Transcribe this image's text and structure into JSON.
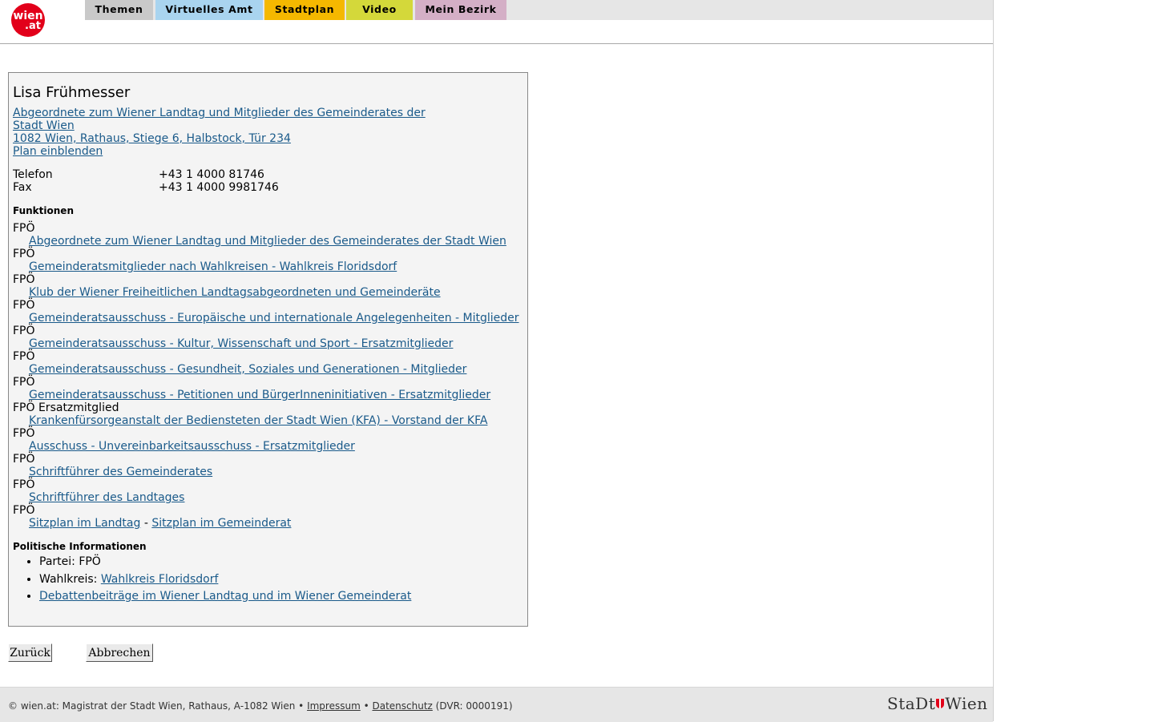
{
  "logo": {
    "line1": "wien",
    "line2": ".at"
  },
  "nav": {
    "tabs": [
      {
        "label": "Themen",
        "color": "#c9c9c9"
      },
      {
        "label": "Virtuelles Amt",
        "color": "#a9d4ef"
      },
      {
        "label": "Stadtplan",
        "color": "#f5b800"
      },
      {
        "label": "Video",
        "color": "#d4d83a"
      },
      {
        "label": "Mein Bezirk",
        "color": "#d4afc6"
      }
    ]
  },
  "person": {
    "name": "Lisa Frühmesser",
    "role_line1": "Abgeordnete zum Wiener Landtag und Mitglieder des Gemeinderates der",
    "role_line2": "Stadt Wien",
    "address": "1082 Wien, Rathaus, Stiege 6, Halbstock, Tür 234",
    "plan_link": "Plan einblenden",
    "phone_label": "Telefon",
    "phone_value": "+43 1 4000 81746",
    "fax_label": "Fax",
    "fax_value": "+43 1 4000 9981746"
  },
  "functions": {
    "title": "Funktionen",
    "items": [
      {
        "party": "FPÖ",
        "link": "Abgeordnete zum Wiener Landtag und Mitglieder des Gemeinderates der Stadt Wien"
      },
      {
        "party": "FPÖ",
        "link": "Gemeinderatsmitglieder nach Wahlkreisen - Wahlkreis Floridsdorf"
      },
      {
        "party": "FPÖ",
        "link": "Klub der Wiener Freiheitlichen Landtagsabgeordneten und Gemeinderäte"
      },
      {
        "party": "FPÖ",
        "link": "Gemeinderatsausschuss - Europäische und internationale Angelegenheiten - Mitglieder"
      },
      {
        "party": "FPÖ",
        "link": "Gemeinderatsausschuss - Kultur, Wissenschaft und Sport - Ersatzmitglieder"
      },
      {
        "party": "FPÖ",
        "link": "Gemeinderatsausschuss - Gesundheit, Soziales und Generationen - Mitglieder"
      },
      {
        "party": "FPÖ",
        "link": "Gemeinderatsausschuss - Petitionen und BürgerInneninitiativen - Ersatzmitglieder"
      },
      {
        "party": "FPÖ Ersatzmitglied",
        "link": "Krankenfürsorgeanstalt der Bediensteten der Stadt Wien (KFA) - Vorstand der KFA"
      },
      {
        "party": "FPÖ",
        "link": "Ausschuss - Unvereinbarkeitsausschuss - Ersatzmitglieder"
      },
      {
        "party": "FPÖ",
        "link": "Schriftführer des Gemeinderates"
      },
      {
        "party": "FPÖ",
        "link": "Schriftführer des Landtages"
      }
    ],
    "last_party": "FPÖ",
    "seat_landtag": "Sitzplan im Landtag",
    "seat_sep": " - ",
    "seat_gemeinderat": "Sitzplan im Gemeinderat"
  },
  "political": {
    "title": "Politische Informationen",
    "party_label": "Partei: ",
    "party_value": "FPÖ",
    "district_label": "Wahlkreis: ",
    "district_value": "Wahlkreis Floridsdorf",
    "debates_link": "Debattenbeiträge im Wiener Landtag und im Wiener Gemeinderat"
  },
  "buttons": {
    "back": "Zurück",
    "cancel": "Abbrechen"
  },
  "footer": {
    "text": "© wien.at: Magistrat der Stadt Wien, Rathaus, A-1082 Wien • ",
    "impressum": "Impressum",
    "sep": " • ",
    "privacy": "Datenschutz",
    "dvr": " (DVR: 0000191)",
    "logo_left": "StaDt",
    "logo_right": "Wien"
  }
}
